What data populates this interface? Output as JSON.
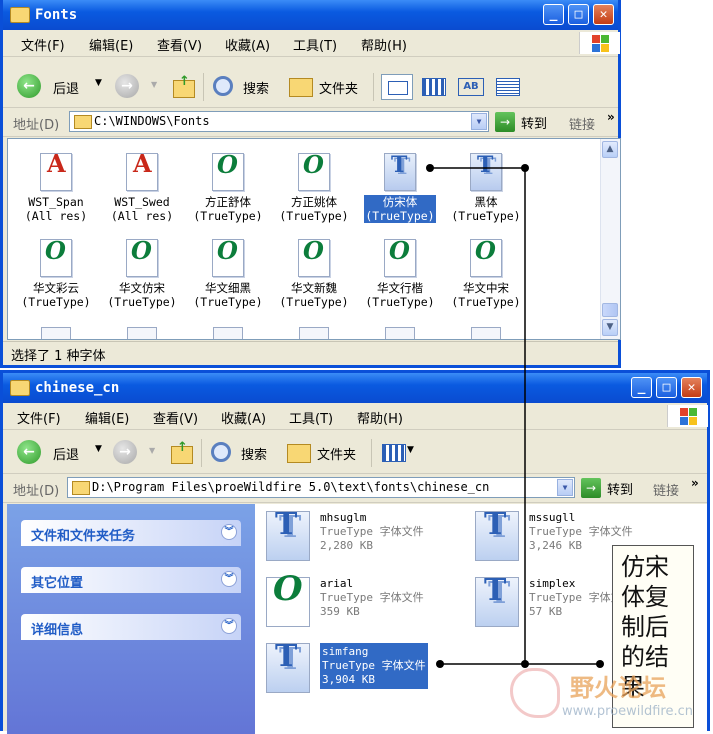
{
  "window1": {
    "title": "Fonts",
    "menu": [
      "文件(F)",
      "编辑(E)",
      "查看(V)",
      "收藏(A)",
      "工具(T)",
      "帮助(H)"
    ],
    "toolbar": {
      "back": "后退",
      "search": "搜索",
      "folders": "文件夹"
    },
    "address": {
      "label": "地址(D)",
      "path": "C:\\WINDOWS\\Fonts",
      "go": "转到",
      "links": "链接"
    },
    "fonts_row1": [
      {
        "name": "WST_Span",
        "type": "(All res)",
        "icon": "adobe-font-icon"
      },
      {
        "name": "WST_Swed",
        "type": "(All res)",
        "icon": "adobe-font-icon"
      },
      {
        "name": "方正舒体",
        "type": "(TrueType)",
        "icon": "opentype-icon"
      },
      {
        "name": "方正姚体",
        "type": "(TrueType)",
        "icon": "opentype-icon"
      },
      {
        "name": "仿宋体",
        "type": "(TrueType)",
        "icon": "truetype-icon",
        "selected": true
      },
      {
        "name": "黑体",
        "type": "(TrueType)",
        "icon": "truetype-icon"
      }
    ],
    "fonts_row2": [
      {
        "name": "华文彩云",
        "type": "(TrueType)",
        "icon": "opentype-icon"
      },
      {
        "name": "华文仿宋",
        "type": "(TrueType)",
        "icon": "opentype-icon"
      },
      {
        "name": "华文细黑",
        "type": "(TrueType)",
        "icon": "opentype-icon"
      },
      {
        "name": "华文新魏",
        "type": "(TrueType)",
        "icon": "opentype-icon"
      },
      {
        "name": "华文行楷",
        "type": "(TrueType)",
        "icon": "opentype-icon"
      },
      {
        "name": "华文中宋",
        "type": "(TrueType)",
        "icon": "opentype-icon"
      }
    ],
    "status": "选择了 1 种字体"
  },
  "window2": {
    "title": "chinese_cn",
    "menu": [
      "文件(F)",
      "编辑(E)",
      "查看(V)",
      "收藏(A)",
      "工具(T)",
      "帮助(H)"
    ],
    "toolbar": {
      "back": "后退",
      "search": "搜索",
      "folders": "文件夹"
    },
    "address": {
      "label": "地址(D)",
      "path": "D:\\Program Files\\proeWildfire 5.0\\text\\fonts\\chinese_cn",
      "go": "转到",
      "links": "链接"
    },
    "tasks": [
      "文件和文件夹任务",
      "其它位置",
      "详细信息"
    ],
    "files": [
      {
        "name": "mhsuglm",
        "type": "TrueType 字体文件",
        "size": "2,280 KB",
        "icon": "truetype-icon"
      },
      {
        "name": "mssugll",
        "type": "TrueType 字体文件",
        "size": "3,246 KB",
        "icon": "truetype-icon"
      },
      {
        "name": "arial",
        "type": "TrueType 字体文件",
        "size": "359 KB",
        "icon": "opentype-icon"
      },
      {
        "name": "simplex",
        "type": "TrueType 字体文件",
        "size": "57 KB",
        "icon": "truetype-icon"
      },
      {
        "name": "simfang",
        "type": "TrueType 字体文件",
        "size": "3,904 KB",
        "icon": "truetype-icon",
        "selected": true
      }
    ]
  },
  "annotation": "仿宋体复制后的结果",
  "watermark": {
    "main": "野火论坛",
    "sub": "www.proewildfire.cn"
  }
}
